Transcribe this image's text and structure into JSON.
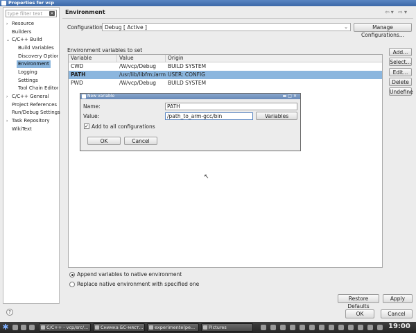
{
  "window": {
    "title": "Properties for vcp"
  },
  "tree": {
    "filter_placeholder": "type filter text",
    "items": [
      {
        "label": "Resource"
      },
      {
        "label": "Builders"
      },
      {
        "label": "C/C++ Build"
      },
      {
        "label": "Build Variables"
      },
      {
        "label": "Discovery Options"
      },
      {
        "label": "Environment"
      },
      {
        "label": "Logging"
      },
      {
        "label": "Settings"
      },
      {
        "label": "Tool Chain Editor"
      },
      {
        "label": "C/C++ General"
      },
      {
        "label": "Project References"
      },
      {
        "label": "Run/Debug Settings"
      },
      {
        "label": "Task Repository"
      },
      {
        "label": "WikiText"
      }
    ]
  },
  "page": {
    "title": "Environment",
    "configuration_label": "Configuration:",
    "configuration_value": "Debug [ Active ]",
    "manage_button": "Manage Configurations...",
    "env_section_label": "Environment variables to set",
    "columns": [
      "Variable",
      "Value",
      "Origin"
    ],
    "rows": [
      {
        "variable": "CWD",
        "value": "/W/vcp/Debug",
        "origin": "BUILD SYSTEM"
      },
      {
        "variable": "PATH",
        "value": "/usr/lib/libfm:/arm/b",
        "origin": "USER: CONFIG"
      },
      {
        "variable": "PWD",
        "value": "/W/vcp/Debug",
        "origin": "BUILD SYSTEM"
      }
    ],
    "side_buttons": [
      "Add...",
      "Select...",
      "Edit...",
      "Delete",
      "Undefine"
    ],
    "radio_append": "Append variables to native environment",
    "radio_replace": "Replace native environment with specified one",
    "restore_defaults": "Restore Defaults",
    "apply": "Apply",
    "ok": "OK",
    "cancel": "Cancel"
  },
  "dialog": {
    "title": "New variable",
    "name_label": "Name:",
    "name_value": "PATH",
    "value_label": "Value:",
    "value_value": "/path_to_arm-gcc/bin",
    "variables_button": "Variables",
    "add_all_label": "Add to all configurations",
    "ok": "OK",
    "cancel": "Cancel"
  },
  "taskbar": {
    "tasks": [
      "C/C++ - vcp/src/...",
      "Снимка БС-мяст...",
      "experimente(pe...",
      "Pictures"
    ],
    "clock": "19:00"
  }
}
